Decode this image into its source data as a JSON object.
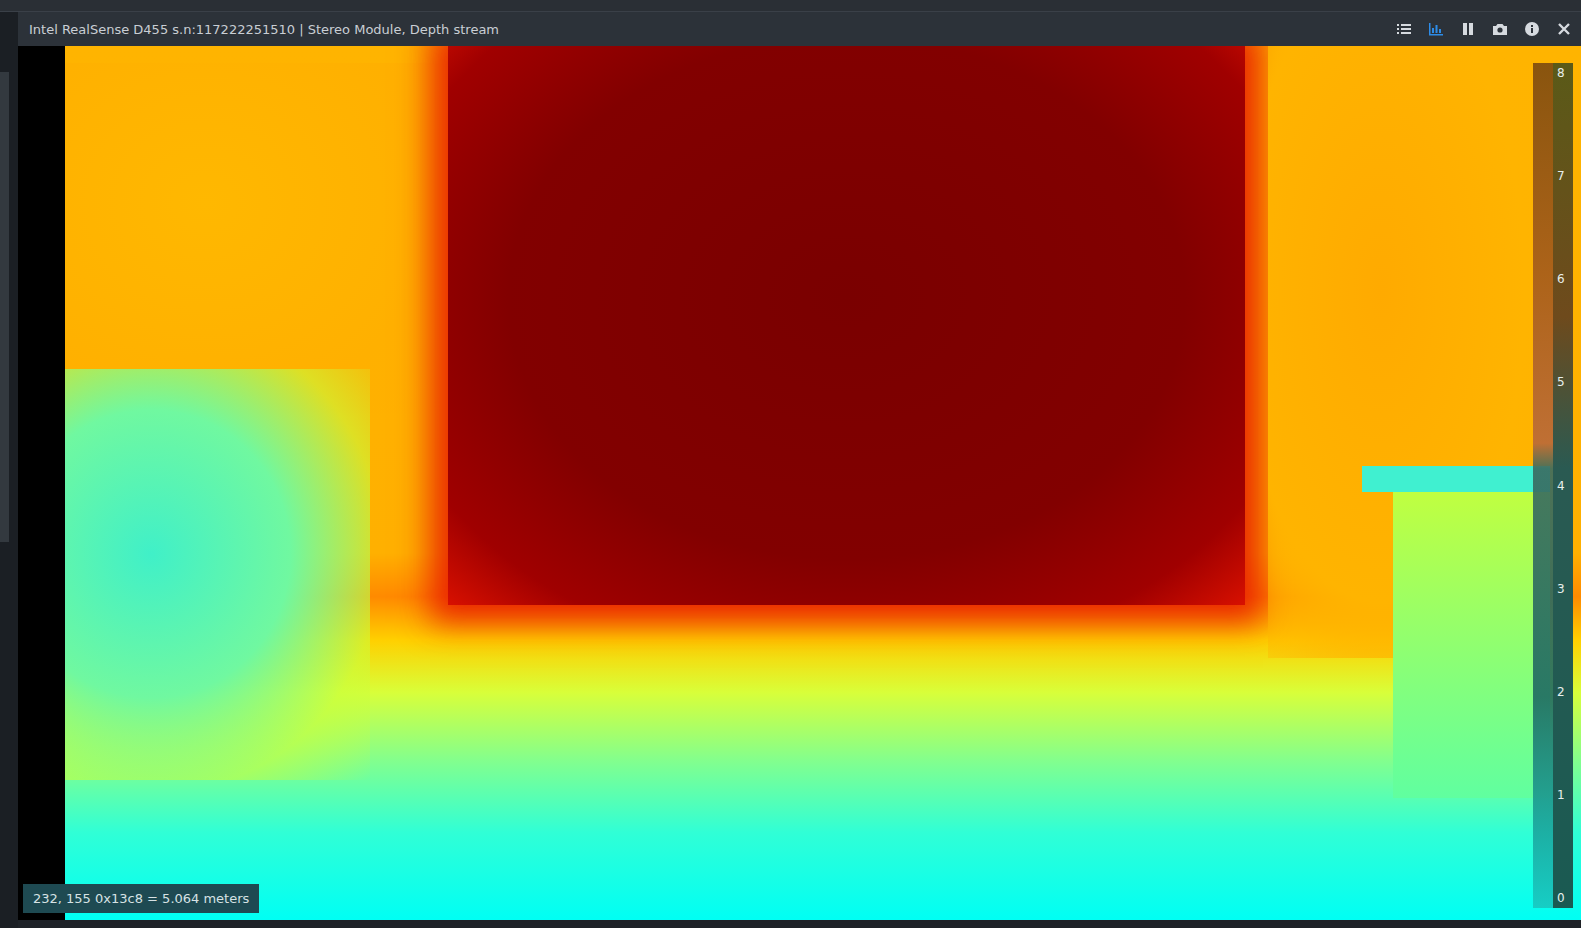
{
  "window": {
    "title": "Intel RealSense D455 s.n:117222251510 | Stereo Module, Depth stream"
  },
  "toolbar": [
    {
      "kind": "options",
      "selected": false
    },
    {
      "kind": "chart",
      "selected": true
    },
    {
      "kind": "pause",
      "selected": false
    },
    {
      "kind": "camera",
      "selected": false
    },
    {
      "kind": "info",
      "selected": false
    },
    {
      "kind": "close",
      "selected": false
    }
  ],
  "depth_view": {
    "colorbar": {
      "ticks": [
        "8",
        "7",
        "6",
        "5",
        "4",
        "3",
        "2",
        "1",
        "0"
      ]
    },
    "readout": "232, 155 0x13c8 = 5.064 meters"
  }
}
